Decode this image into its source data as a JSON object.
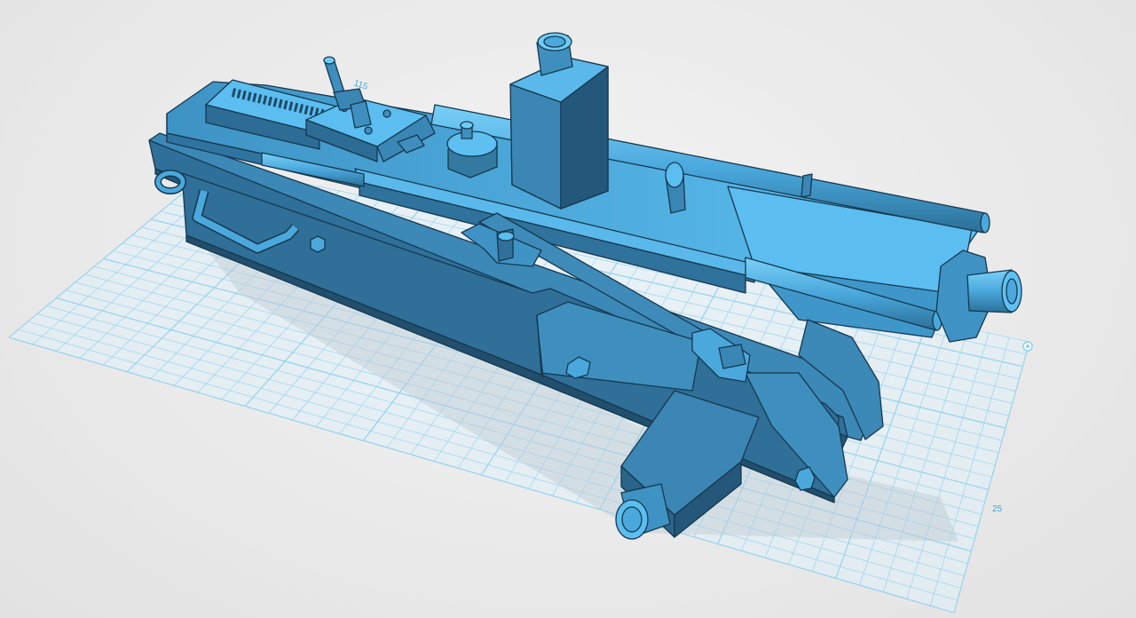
{
  "viewport": {
    "grid_labels": {
      "y_extent": "115",
      "x_extent": "25"
    },
    "colors": {
      "model": "#4aa8dc",
      "model_light": "#5fc0f2",
      "model_dark": "#2b6f97",
      "model_shadow": "#1f4f6e",
      "grid_line": "#8fd0ee",
      "grid_fill": "#dff1f9"
    },
    "icons": [
      "grid-origin-marker-icon"
    ]
  }
}
